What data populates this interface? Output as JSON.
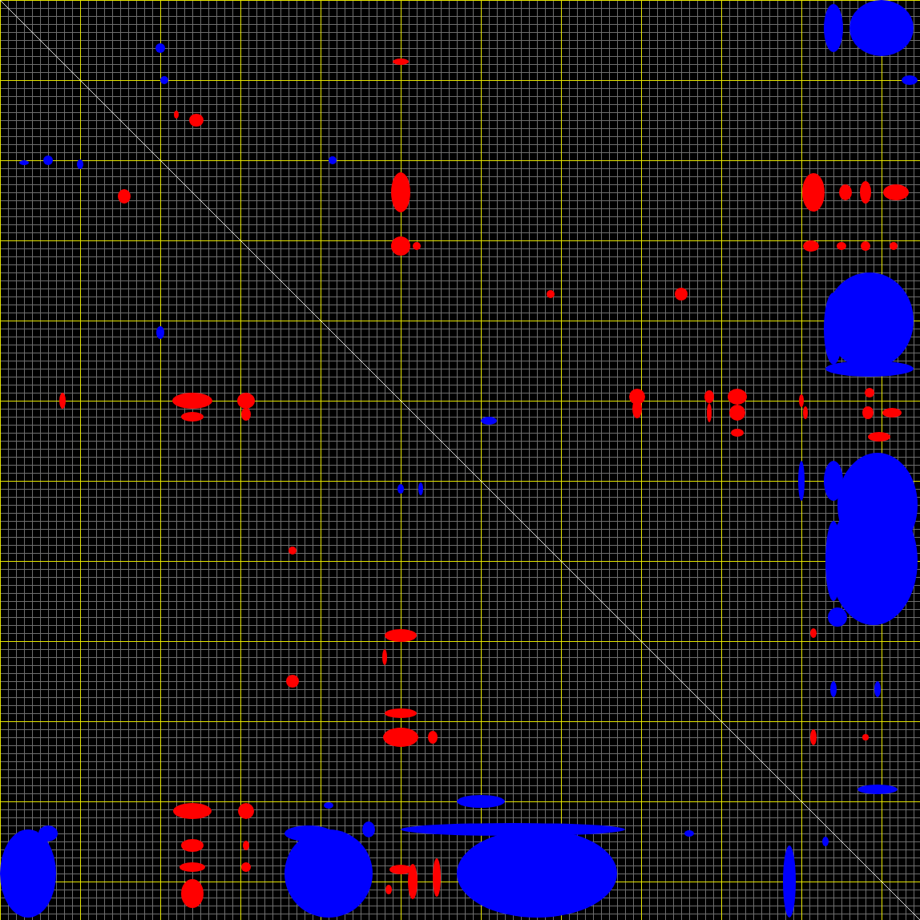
{
  "plot": {
    "diagonal": true,
    "peak_groups": [
      {
        "color": "#ff0000"
      },
      {
        "color": "#0000ff"
      }
    ]
  }
}
